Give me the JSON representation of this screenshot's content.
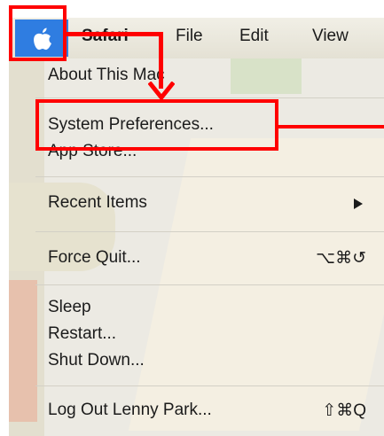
{
  "menubar": {
    "apple_icon": "apple-logo",
    "items": [
      {
        "label": "Safari"
      },
      {
        "label": "File"
      },
      {
        "label": "Edit"
      },
      {
        "label": "View"
      }
    ]
  },
  "apple_menu": {
    "items": [
      {
        "label": "About This Mac"
      },
      {
        "label": "System Preferences..."
      },
      {
        "label": "App Store..."
      },
      {
        "label": "Recent Items",
        "submenu_icon": "triangle-right"
      },
      {
        "label": "Force Quit...",
        "shortcut": "⌥⌘↺"
      },
      {
        "label": "Sleep"
      },
      {
        "label": "Restart..."
      },
      {
        "label": "Shut Down..."
      },
      {
        "label": "Log Out Lenny Park...",
        "shortcut": "⇧⌘Q"
      }
    ]
  },
  "annotation": {
    "color": "#ff0000"
  },
  "colors": {
    "apple_highlight": "#2f7de1",
    "menu_background": "#eceae3"
  }
}
